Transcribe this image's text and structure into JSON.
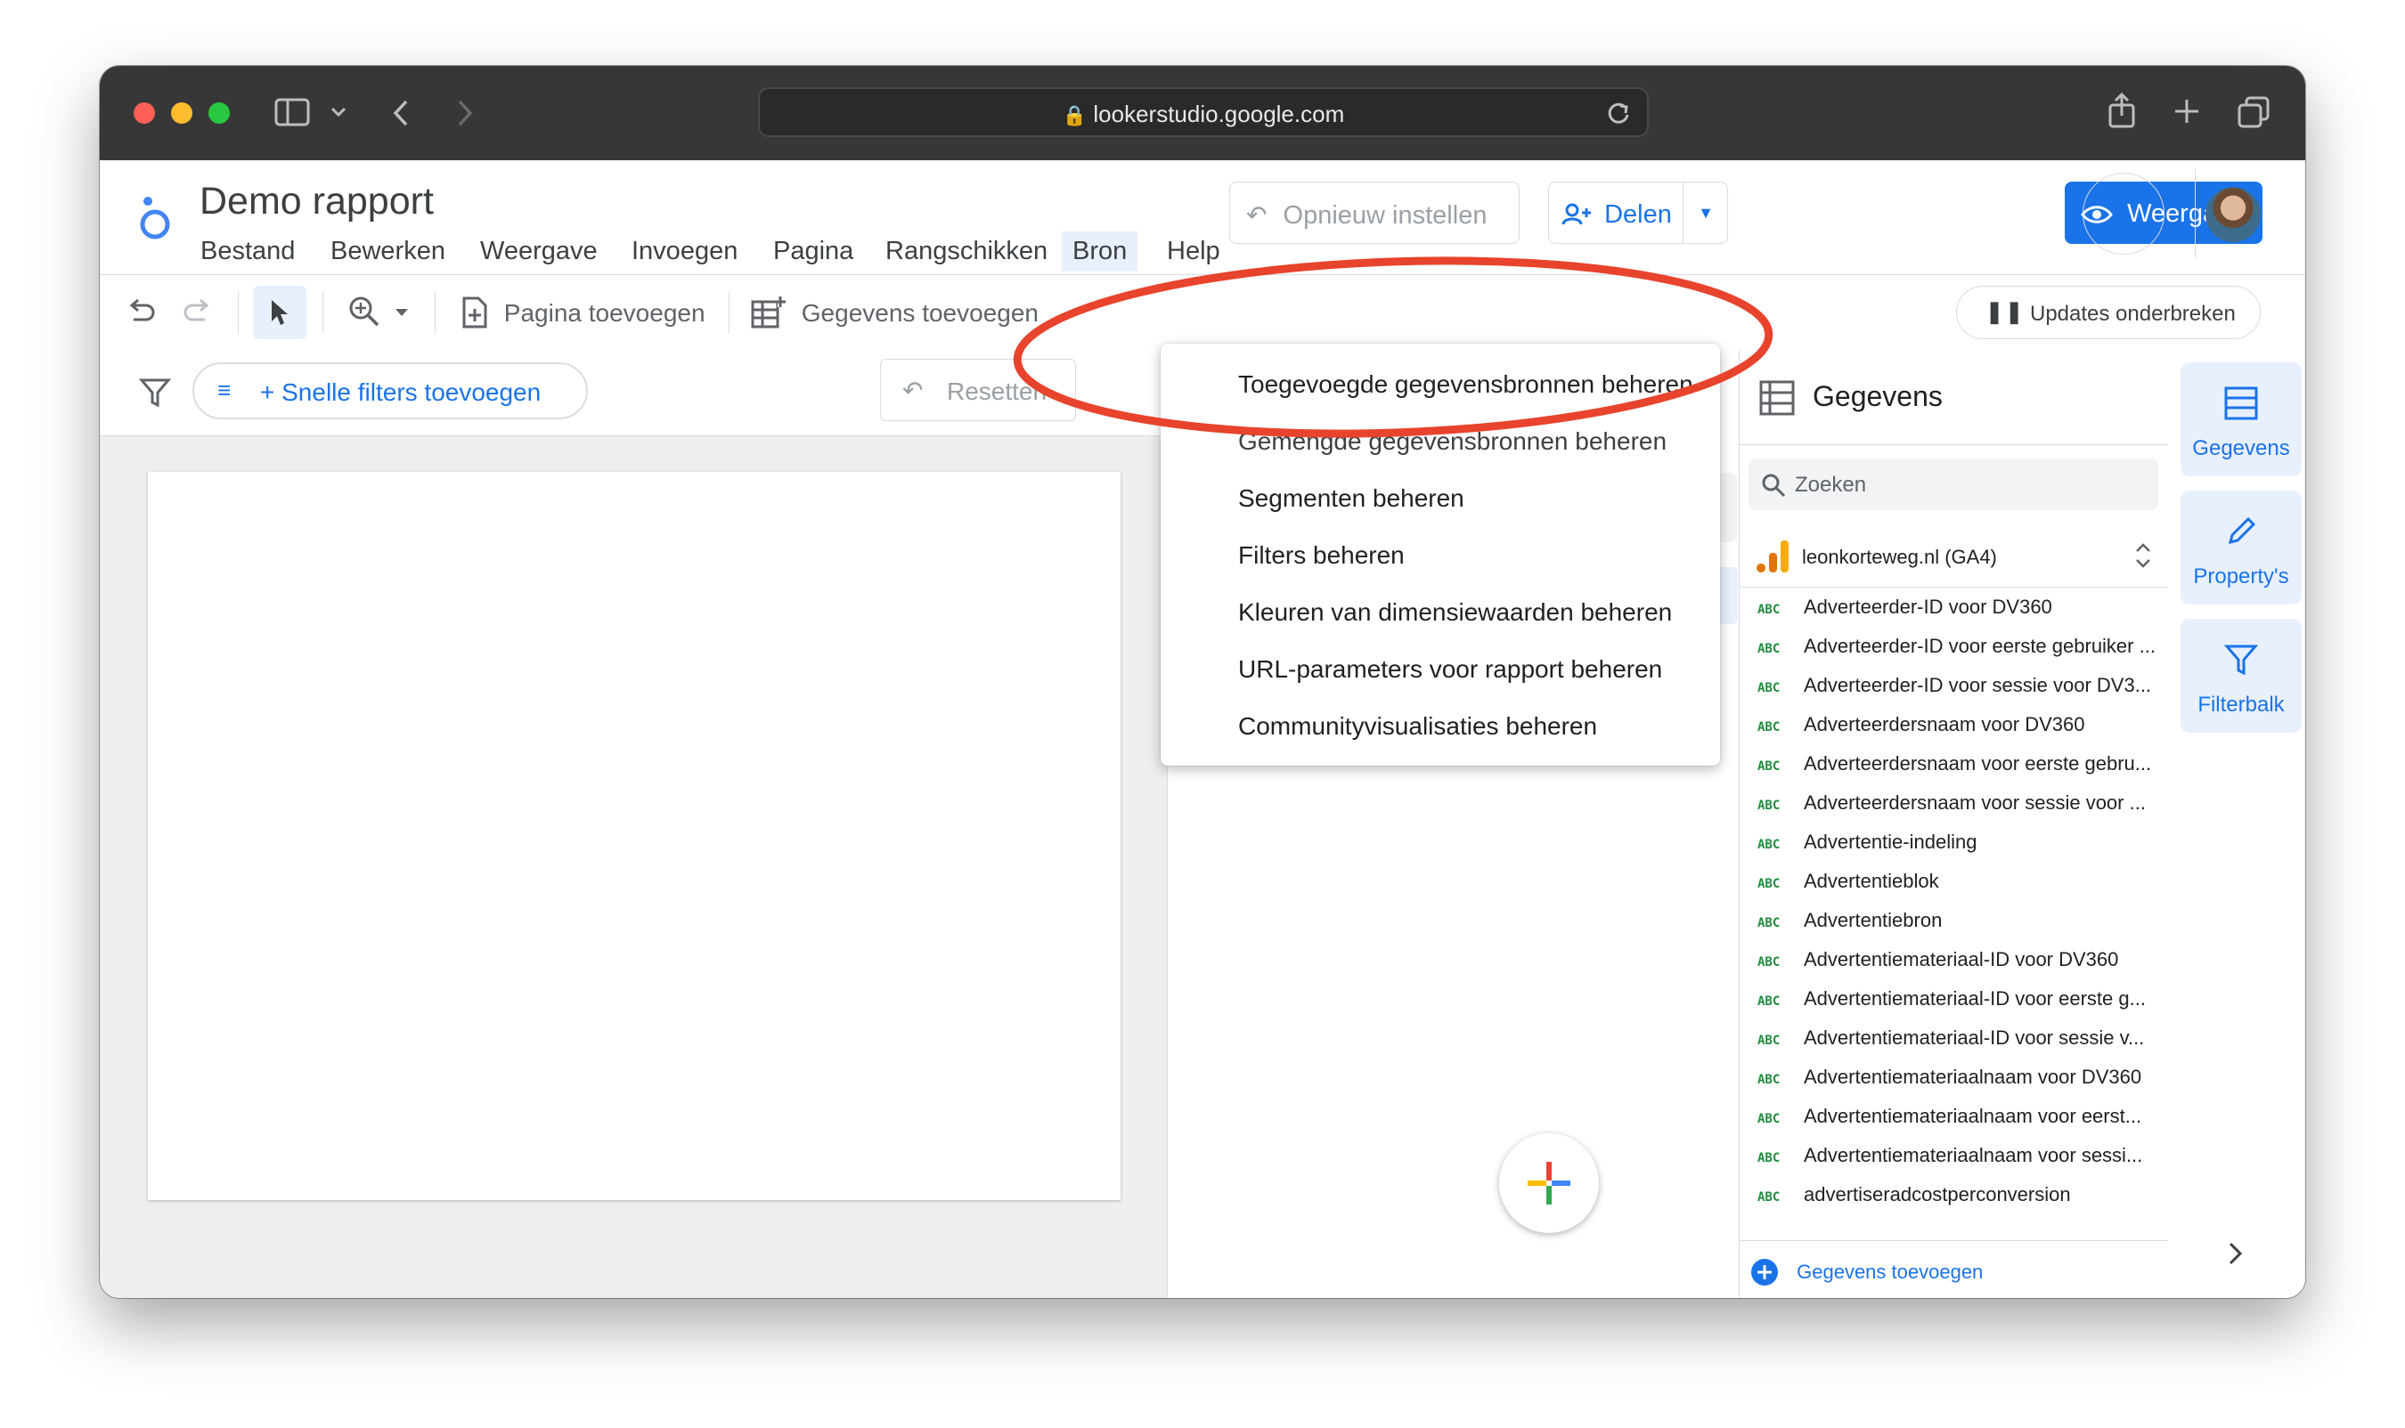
{
  "browser": {
    "url": "lookerstudio.google.com"
  },
  "app": {
    "title": "Demo rapport",
    "menu": [
      "Bestand",
      "Bewerken",
      "Weergave",
      "Invoegen",
      "Pagina",
      "Rangschikken",
      "Bron",
      "Help"
    ],
    "reset_button": "Opnieuw instellen",
    "share_button": "Delen",
    "view_button": "Weergave"
  },
  "toolbar": {
    "add_page": "Pagina toevoegen",
    "add_data": "Gegevens toevoegen",
    "pause_updates": "Updates onderbreken"
  },
  "filterbar": {
    "quick_filters": "+ Snelle filters toevoegen",
    "reset": "Resetten"
  },
  "dropdown": {
    "items": [
      "Toegevoegde gegevensbronnen beheren",
      "Gemengde gegevensbronnen beheren",
      "Segmenten beheren",
      "Filters beheren",
      "Kleuren van dimensiewaarden beheren",
      "URL-parameters voor rapport beheren",
      "Communityvisualisaties beheren"
    ]
  },
  "data_panel": {
    "title": "Gegevens",
    "search_placeholder": "Zoeken",
    "source": "leonkorteweg.nl (GA4)",
    "field_type": "ABC",
    "fields": [
      "Adverteerder-ID voor DV360",
      "Adverteerder-ID voor eerste gebruiker ...",
      "Adverteerder-ID voor sessie voor DV3...",
      "Adverteerdersnaam voor DV360",
      "Adverteerdersnaam voor eerste gebru...",
      "Adverteerdersnaam voor sessie voor ...",
      "Advertentie-indeling",
      "Advertentieblok",
      "Advertentiebron",
      "Advertentiemateriaal-ID voor DV360",
      "Advertentiemateriaal-ID voor eerste g...",
      "Advertentiemateriaal-ID voor sessie v...",
      "Advertentiemateriaalnaam voor DV360",
      "Advertentiemateriaalnaam voor eerst...",
      "Advertentiemateriaalnaam voor sessi...",
      "advertiseradcostperconversion"
    ],
    "add_data": "Gegevens toevoegen"
  },
  "rail": {
    "data": "Gegevens",
    "properties": "Property's",
    "filterbar": "Filterbalk"
  },
  "colors": {
    "accent": "#1a73e8",
    "annotation": "#e8432c",
    "titlebar": "#373737"
  }
}
